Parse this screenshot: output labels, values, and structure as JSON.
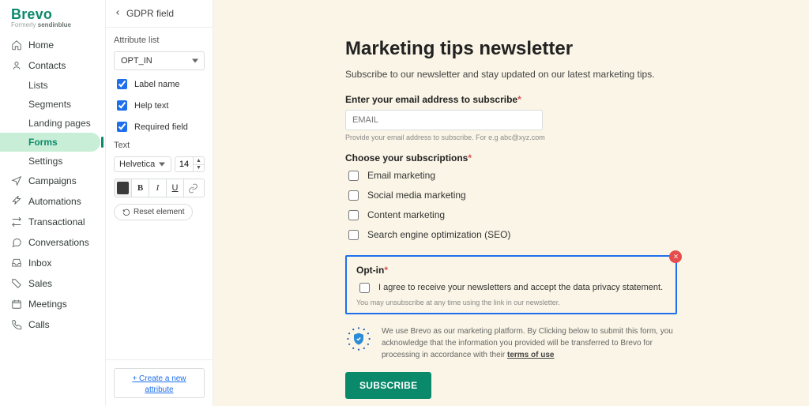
{
  "brand": {
    "name": "Brevo",
    "tagline_prefix": "Formerly ",
    "tagline_strong": "sendinblue"
  },
  "nav": {
    "home": "Home",
    "contacts": "Contacts",
    "lists": "Lists",
    "segments": "Segments",
    "landing": "Landing pages",
    "forms": "Forms",
    "settings": "Settings",
    "campaigns": "Campaigns",
    "automations": "Automations",
    "transactional": "Transactional",
    "conversations": "Conversations",
    "inbox": "Inbox",
    "sales": "Sales",
    "meetings": "Meetings",
    "calls": "Calls"
  },
  "panel": {
    "title": "GDPR field",
    "attribute_label": "Attribute list",
    "attribute_value": "OPT_IN",
    "label_name": "Label name",
    "help_text": "Help text",
    "required_field": "Required field",
    "text_label": "Text",
    "font": "Helvetica",
    "font_size": "14",
    "reset": "Reset element",
    "add_attr": "+ Create a new attribute"
  },
  "form": {
    "title": "Marketing tips newsletter",
    "description": "Subscribe to our newsletter and stay updated on our latest marketing tips.",
    "email_label": "Enter your email address to subscribe",
    "email_placeholder": "EMAIL",
    "email_help": "Provide your email address to subscribe. For e.g abc@xyz.com",
    "subs_label": "Choose your subscriptions",
    "subs": {
      "a": "Email marketing",
      "b": "Social media marketing",
      "c": "Content marketing",
      "d": "Search engine optimization (SEO)"
    },
    "optin_title": "Opt-in",
    "optin_text": "I agree to receive your newsletters and accept the data privacy statement.",
    "optin_help": "You may unsubscribe at any time using the link in our newsletter.",
    "gdpr_text": "We use Brevo as our marketing platform. By Clicking below to submit this form, you acknowledge that the information you provided will be transferred to Brevo for processing in accordance with their ",
    "gdpr_link": "terms of use",
    "subscribe": "SUBSCRIBE"
  }
}
